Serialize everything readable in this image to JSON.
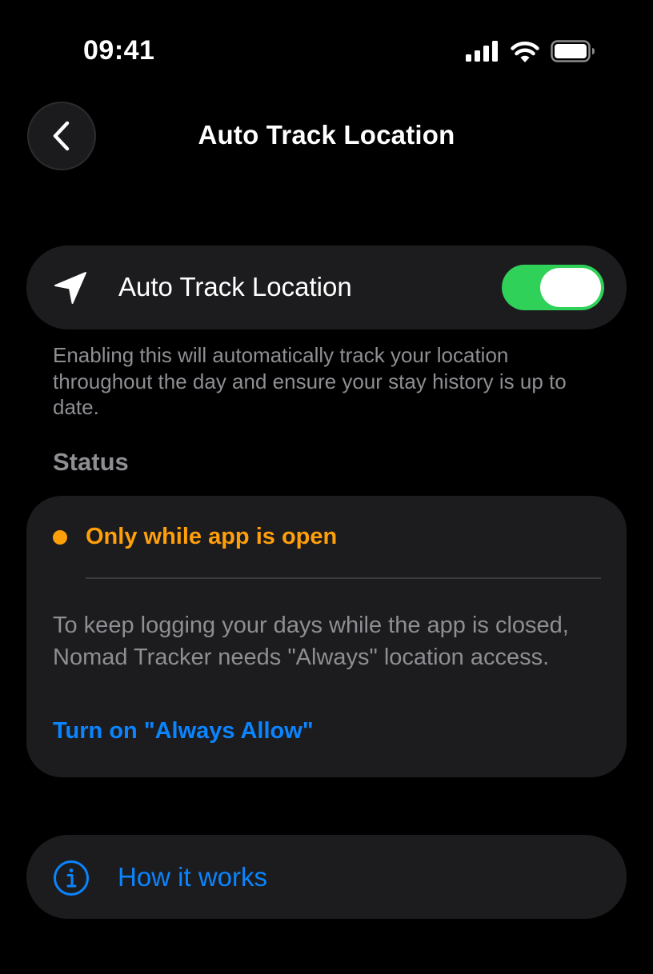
{
  "status_bar": {
    "time": "09:41"
  },
  "header": {
    "back_icon": "chevron-left-icon",
    "title": "Auto Track Location"
  },
  "toggle_row": {
    "icon": "location-arrow-icon",
    "label": "Auto Track Location",
    "enabled": true,
    "accent_color": "#30d158"
  },
  "description": "Enabling this will automatically track your location throughout the day and ensure your stay history is up to date.",
  "status_section": {
    "title": "Status",
    "state_text": "Only while app is open",
    "state_color": "#ff9f0a",
    "body": "To keep logging your days while the app is closed, Nomad Tracker needs \"Always\" location access.",
    "action_label": "Turn on \"Always Allow\"",
    "action_color": "#0a84ff"
  },
  "how_it_works": {
    "icon": "info-circle-icon",
    "label": "How it works"
  }
}
